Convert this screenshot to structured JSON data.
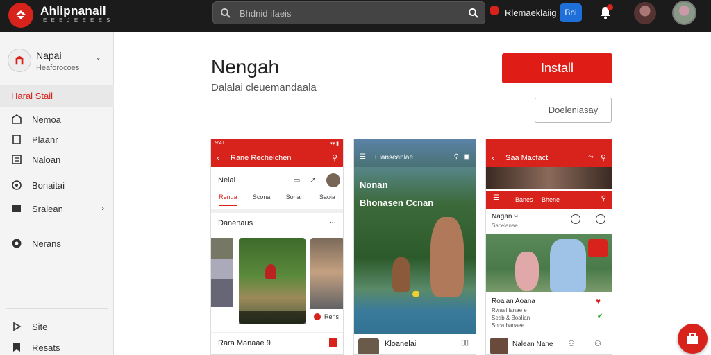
{
  "topbar": {
    "brand": "Ahlipnanail",
    "brand_sub": "E E E J  E E E E S",
    "search_placeholder": "Bhdnid ifaeis",
    "link": "Rlemaeklaiig",
    "blue_btn": "Bni"
  },
  "sidebar": {
    "profile_name": "Napai",
    "profile_sub": "Heaforocoes",
    "active": "Haral Stail",
    "items": [
      "Nemoa",
      "Plaanr",
      "Naloan",
      "Bonaitai",
      "Sralean",
      "Nerans",
      "Site",
      "Resats"
    ]
  },
  "main": {
    "title": "Nengah",
    "subtitle": "Dalalai cleuemandaala",
    "install_label": "Install",
    "secondary_label": "Doeleniasay"
  },
  "screenshot1": {
    "time": "9:41",
    "status": "▾▾ ▮",
    "bar_title": "Rane Rechelchen",
    "header_title": "Nelai",
    "tabs": [
      "Renda",
      "Scona",
      "Sonan",
      "Saoia"
    ],
    "section_title": "Danenaus",
    "section_more": "···",
    "card_label": "Rens",
    "bottom_title": "Rara Manaae 9"
  },
  "screenshot2": {
    "header_title": "Elanseanlae",
    "overlay_title": "Nonan",
    "overlay_sub": "Bhonasen Ccnan",
    "bottom_title": "Kloanelai"
  },
  "screenshot3": {
    "bar_title": "Saa Macfact",
    "tabs": [
      "Banes",
      "Bhene"
    ],
    "row_title": "Nagan 9",
    "row_sub": "Sacelanae",
    "info_title": "Roalan Aoana",
    "info_l1": "Rwael lanae e",
    "info_l2": "Seab & Boalian",
    "info_l3": "Snca banaee",
    "bottom_title": "Nalean Nane"
  },
  "colors": {
    "accent": "#d7231c",
    "topbar": "#1b1b1b",
    "blue": "#1e6fd9"
  }
}
